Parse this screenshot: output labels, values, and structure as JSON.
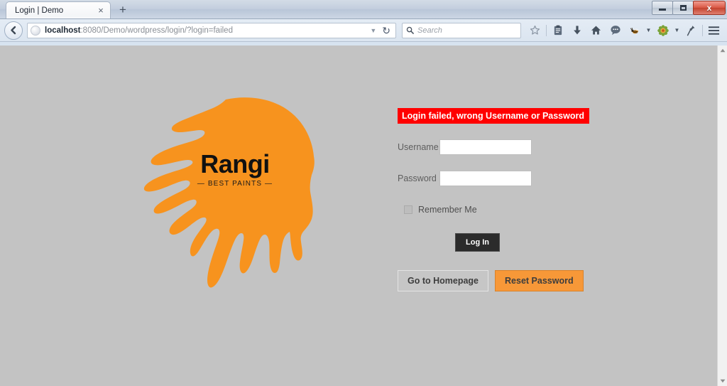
{
  "window": {
    "controls": {
      "minimize": "Minimize",
      "maximize": "Maximize",
      "close": "x"
    }
  },
  "browser": {
    "tab": {
      "title": "Login | Demo",
      "close_label": "×"
    },
    "newtab_label": "+",
    "url": {
      "host": "localhost",
      "rest": ":8080/Demo/wordpress/login/?login=failed",
      "full": "localhost:8080/Demo/wordpress/login/?login=failed"
    },
    "search": {
      "placeholder": "Search"
    },
    "toolbar_icons": [
      "bookmark-star-icon",
      "reading-list-icon",
      "downloads-icon",
      "home-icon",
      "chat-bubble-icon",
      "extension-bee-icon",
      "extension-flower-icon",
      "pin-tool-icon",
      "hamburger-menu-icon"
    ]
  },
  "page": {
    "background_color": "#c3c3c3",
    "logo": {
      "word": "Rangi",
      "tagline": "— BEST PAINTS —",
      "splatter_color": "#f7931e"
    },
    "form": {
      "error_message": "Login failed, wrong Username or Password",
      "error_bg": "#ff0000",
      "username": {
        "label": "Username",
        "value": "",
        "placeholder": ""
      },
      "password": {
        "label": "Password",
        "value": "",
        "placeholder": ""
      },
      "remember": {
        "label": "Remember Me",
        "checked": false
      },
      "login_button": "Log In",
      "homepage_button": "Go to Homepage",
      "reset_button": "Reset Password",
      "reset_button_color": "#f79838"
    }
  }
}
